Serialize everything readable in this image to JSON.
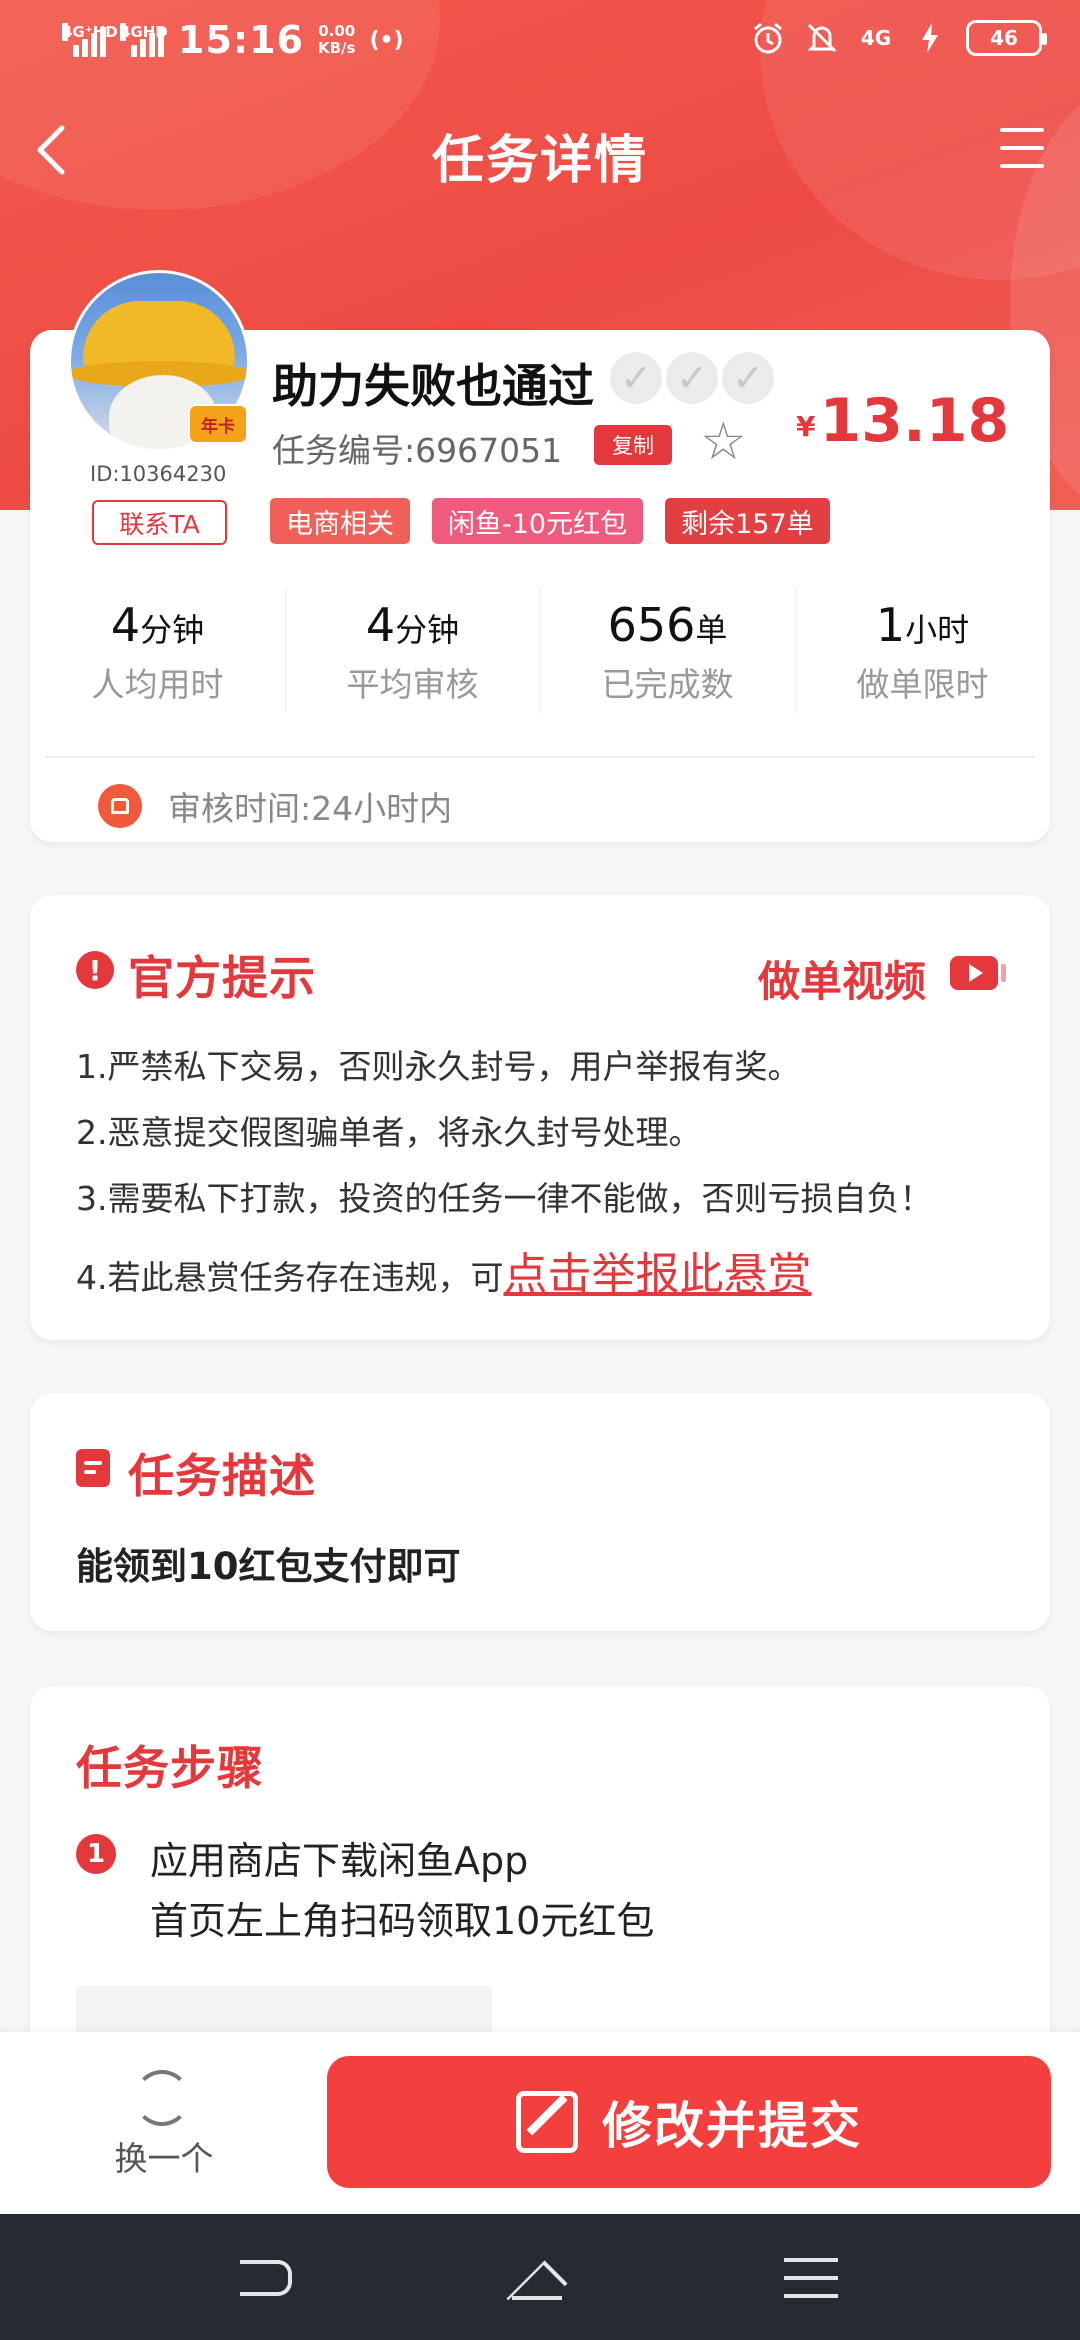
{
  "status": {
    "net1": "4G⁺HD",
    "net2": "4GHD",
    "time": "15:16",
    "speed_val": "0.00",
    "speed_unit": "KB/s",
    "hotspot": "(•)",
    "net3": "4G",
    "battery": "46"
  },
  "header": {
    "title": "任务详情"
  },
  "task": {
    "title": "助力失败也通过",
    "ticks": [
      "✓",
      "✓",
      "✓"
    ],
    "number": "任务编号:6967051",
    "copy_label": "复制",
    "star": "☆",
    "currency": "¥",
    "price": "13.18",
    "user_id": "ID:10364230",
    "avatar_badge": "年卡",
    "contact_label": "联系TA",
    "tags": [
      {
        "label": "电商相关",
        "color": "#f0605a"
      },
      {
        "label": "闲鱼-10元红包",
        "color": "#ef5b7e"
      },
      {
        "label": "剩余157单",
        "color": "#e23f42"
      }
    ],
    "stats": [
      {
        "value": "4",
        "unit": "分钟",
        "label": "人均用时"
      },
      {
        "value": "4",
        "unit": "分钟",
        "label": "平均审核"
      },
      {
        "value": "656",
        "unit": "单",
        "label": "已完成数"
      },
      {
        "value": "1",
        "unit": "小时",
        "label": "做单限时"
      }
    ],
    "audit_time": "审核时间:24小时内"
  },
  "tips": {
    "icon": "!",
    "title": "官方提示",
    "video_label": "做单视频",
    "rules": [
      "1.严禁私下交易，否则永久封号，用户举报有奖。",
      "2.恶意提交假图骗单者，将永久封号处理。",
      "3.需要私下打款，投资的任务一律不能做，否则亏损自负！"
    ],
    "rule4_prefix": "4.若此悬赏任务存在违规，可",
    "report_link": "点击举报此悬赏"
  },
  "description": {
    "title": "任务描述",
    "text": "能领到10红包支付即可"
  },
  "steps": {
    "title": "任务步骤",
    "items": [
      {
        "num": "1",
        "lines": [
          "应用商店下载闲鱼App",
          "首页左上角扫码领取10元红包"
        ]
      }
    ]
  },
  "bottom": {
    "swap_label": "换一个",
    "submit_label": "修改并提交"
  }
}
